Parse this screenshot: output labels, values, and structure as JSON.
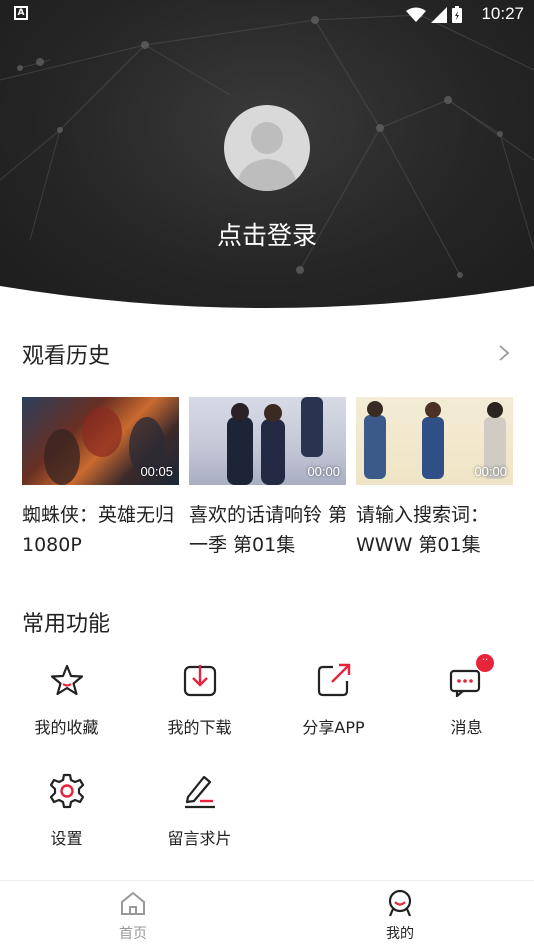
{
  "status_bar": {
    "time": "10:27",
    "notification_badge": "A"
  },
  "profile": {
    "login_text": "点击登录"
  },
  "history": {
    "title": "观看历史",
    "items": [
      {
        "title": "蜘蛛侠：英雄无归 1080P",
        "duration": "00:05"
      },
      {
        "title": "喜欢的话请响铃 第一季 第01集",
        "duration": "00:00"
      },
      {
        "title": "请输入搜索词：WWW 第01集",
        "duration": "00:00"
      }
    ]
  },
  "functions": {
    "title": "常用功能",
    "items": [
      {
        "label": "我的收藏",
        "icon": "star-icon"
      },
      {
        "label": "我的下载",
        "icon": "download-icon"
      },
      {
        "label": "分享APP",
        "icon": "share-icon"
      },
      {
        "label": "消息",
        "icon": "message-icon",
        "badge": "··"
      },
      {
        "label": "设置",
        "icon": "gear-icon"
      },
      {
        "label": "留言求片",
        "icon": "edit-icon"
      }
    ]
  },
  "nav": {
    "items": [
      {
        "label": "首页",
        "icon": "home-icon",
        "active": false
      },
      {
        "label": "我的",
        "icon": "profile-icon",
        "active": true
      }
    ]
  },
  "colors": {
    "accent": "#e8243d",
    "header_bg": "#262626",
    "inactive": "#999999"
  }
}
